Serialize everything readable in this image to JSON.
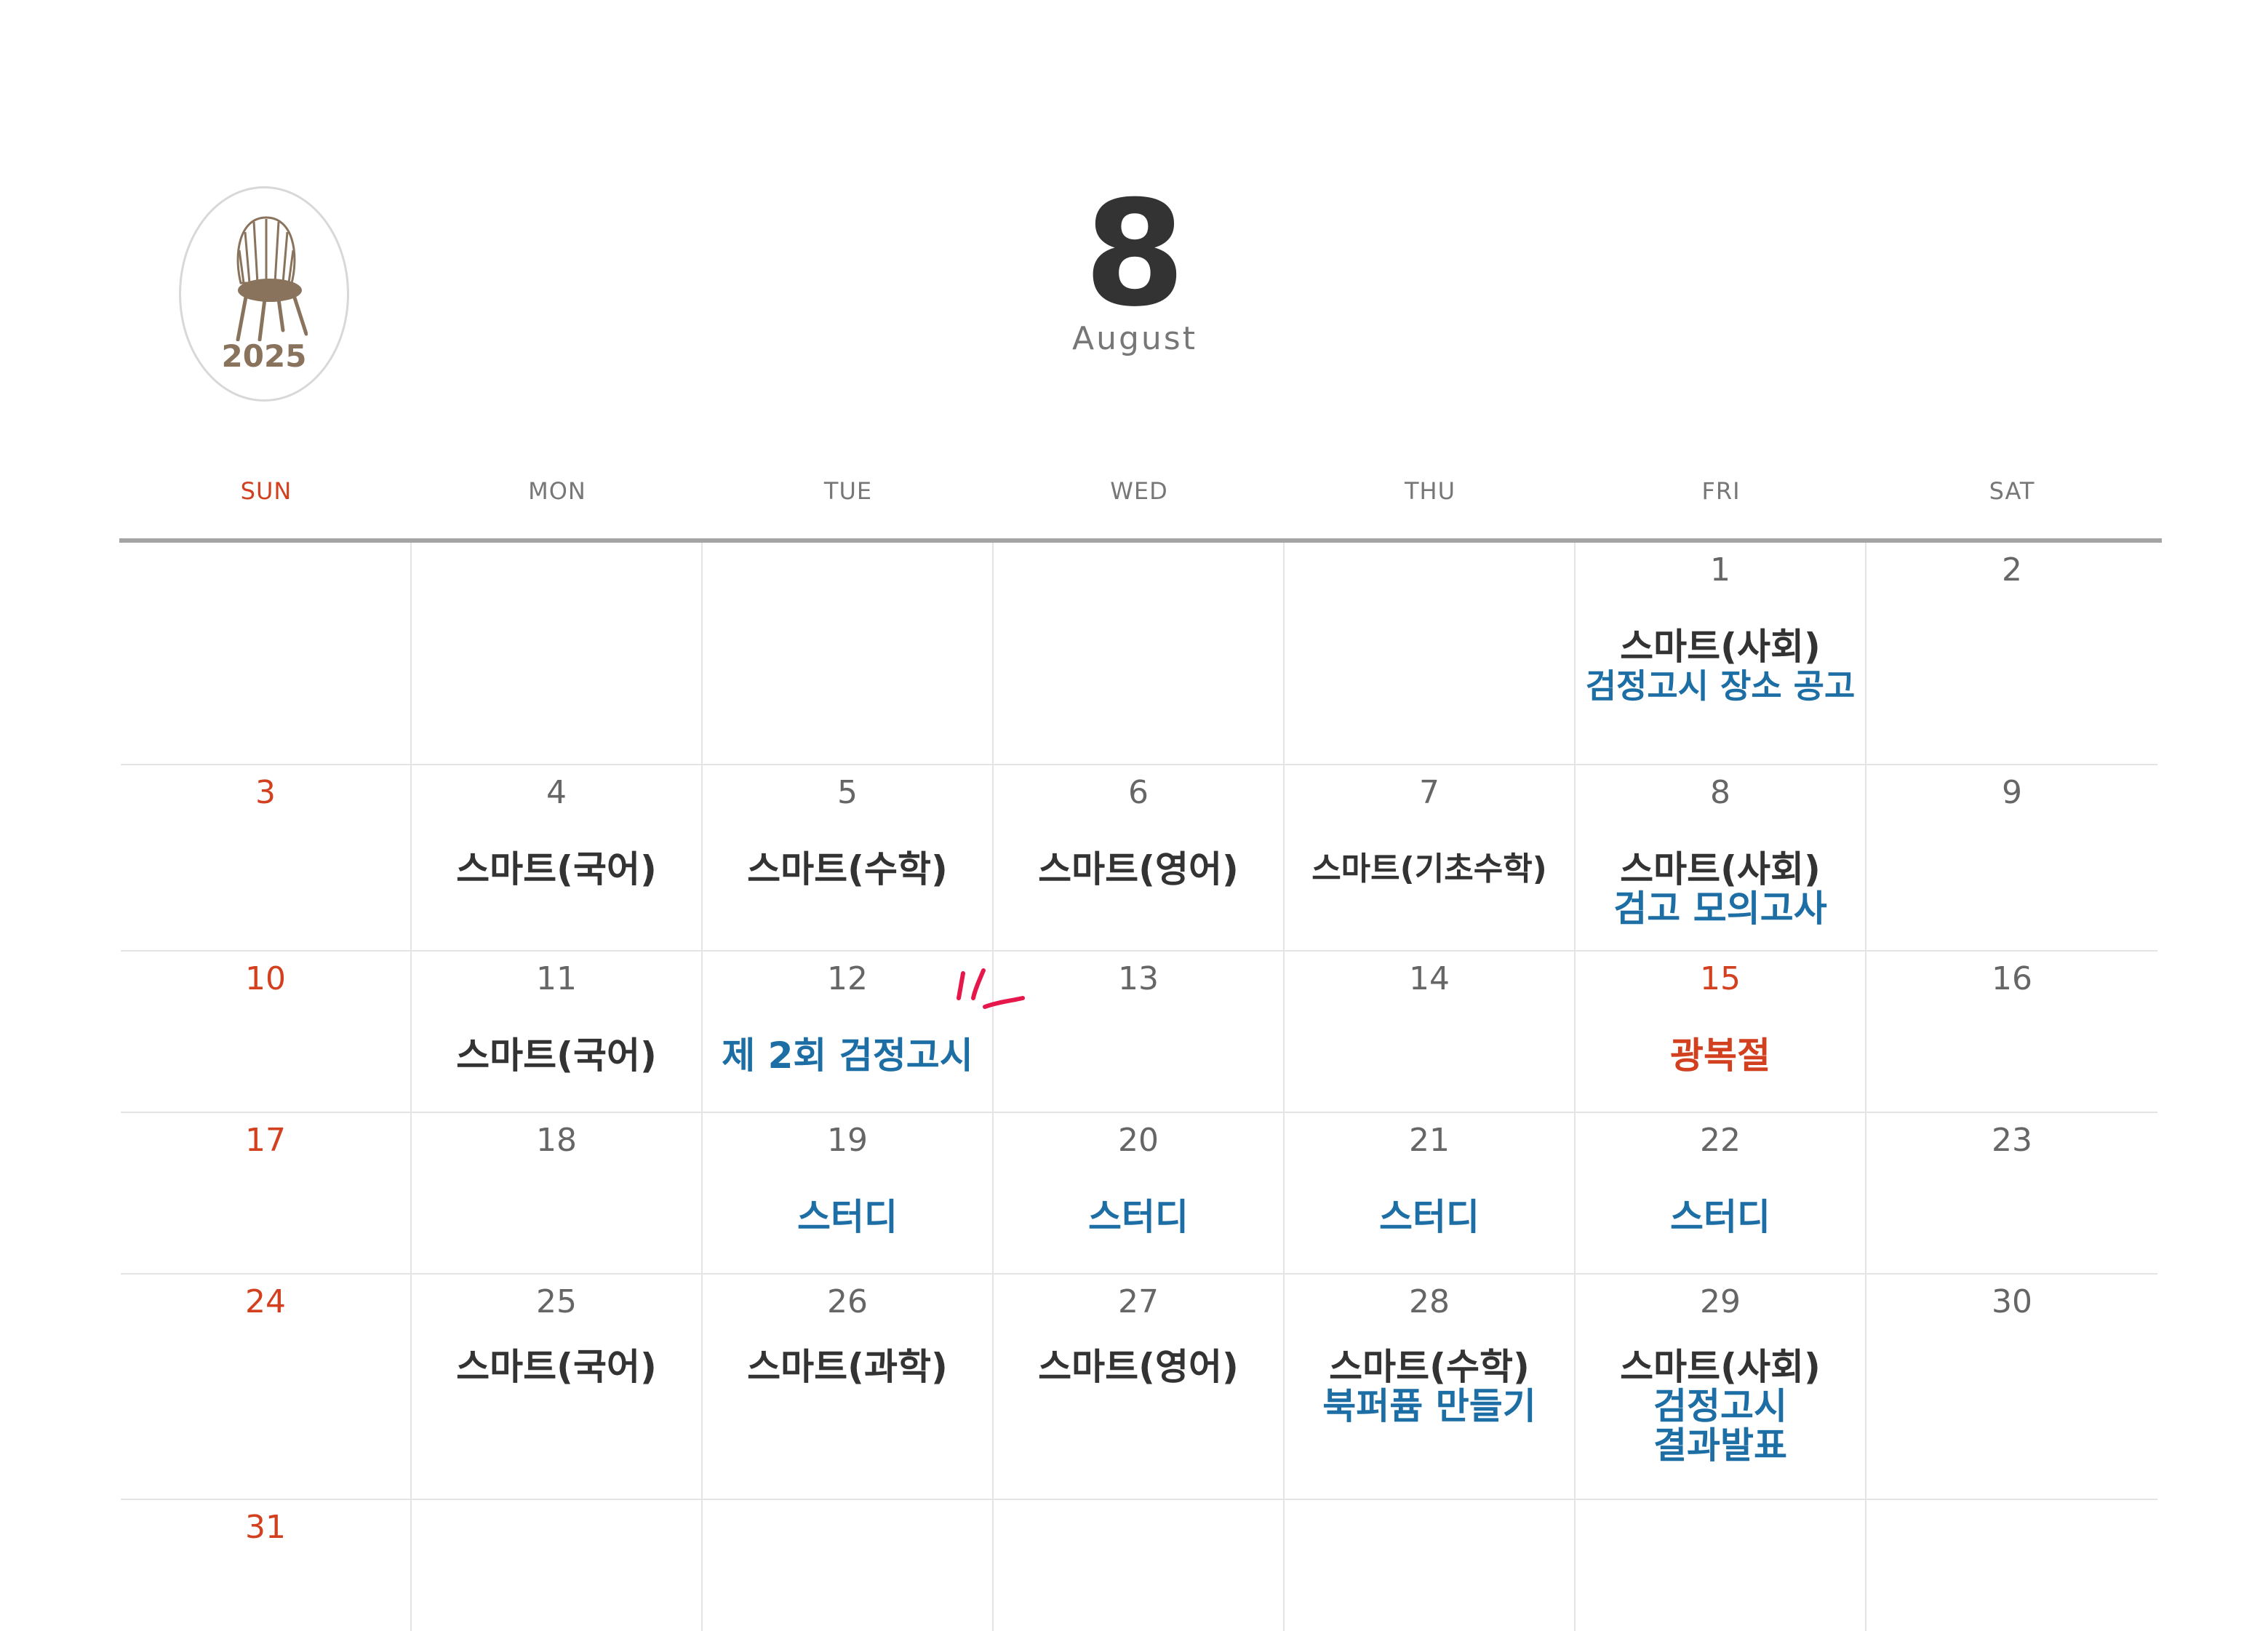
{
  "logo": {
    "year": "2025",
    "icon": "chair-icon",
    "color": "#8a735c"
  },
  "month": {
    "number": "8",
    "name": "August"
  },
  "weekdays": [
    "SUN",
    "MON",
    "TUE",
    "WED",
    "THU",
    "FRI",
    "SAT"
  ],
  "colors": {
    "sunday": "#d2401f",
    "event_dark": "#333333",
    "event_blue": "#1c6ea4",
    "grid": "#e4e4e4",
    "header_rule": "#a4a4a4"
  },
  "annotation": {
    "icon": "red-marker-strokes-icon"
  },
  "weeks": [
    {
      "days": [
        {
          "n": "",
          "events": []
        },
        {
          "n": "",
          "events": []
        },
        {
          "n": "",
          "events": []
        },
        {
          "n": "",
          "events": []
        },
        {
          "n": "",
          "events": []
        },
        {
          "n": "1",
          "events": [
            {
              "t": "스마트(사회)",
              "s": "big"
            },
            {
              "t": "검정고시 장소 공고",
              "s": "blue"
            }
          ]
        },
        {
          "n": "2",
          "events": []
        }
      ]
    },
    {
      "days": [
        {
          "n": "3",
          "red": true,
          "events": []
        },
        {
          "n": "4",
          "events": [
            {
              "t": "스마트(국어)",
              "s": "big"
            }
          ]
        },
        {
          "n": "5",
          "events": [
            {
              "t": "스마트(수학)",
              "s": "big"
            }
          ]
        },
        {
          "n": "6",
          "events": [
            {
              "t": "스마트(영어)",
              "s": "big"
            }
          ]
        },
        {
          "n": "7",
          "events": [
            {
              "t": "스마트(기초수학)",
              "s": "big tight"
            }
          ]
        },
        {
          "n": "8",
          "events": [
            {
              "t": "스마트(사회)",
              "s": "big"
            },
            {
              "t": "검고 모의고사",
              "s": "blue-big"
            }
          ]
        },
        {
          "n": "9",
          "events": []
        }
      ]
    },
    {
      "days": [
        {
          "n": "10",
          "red": true,
          "events": []
        },
        {
          "n": "11",
          "events": [
            {
              "t": "스마트(국어)",
              "s": "big"
            }
          ]
        },
        {
          "n": "12",
          "events": [
            {
              "t": "제 2회 검정고시",
              "s": "blue-big"
            }
          ]
        },
        {
          "n": "13",
          "events": []
        },
        {
          "n": "14",
          "events": []
        },
        {
          "n": "15",
          "red": true,
          "events": [
            {
              "t": "광복절",
              "s": "holiday"
            }
          ]
        },
        {
          "n": "16",
          "events": []
        }
      ]
    },
    {
      "days": [
        {
          "n": "17",
          "red": true,
          "events": []
        },
        {
          "n": "18",
          "events": []
        },
        {
          "n": "19",
          "events": [
            {
              "t": "스터디",
              "s": "blue-big"
            }
          ]
        },
        {
          "n": "20",
          "events": [
            {
              "t": "스터디",
              "s": "blue-big"
            }
          ]
        },
        {
          "n": "21",
          "events": [
            {
              "t": "스터디",
              "s": "blue-big"
            }
          ]
        },
        {
          "n": "22",
          "events": [
            {
              "t": "스터디",
              "s": "blue-big"
            }
          ]
        },
        {
          "n": "23",
          "events": []
        }
      ]
    },
    {
      "days": [
        {
          "n": "24",
          "red": true,
          "events": []
        },
        {
          "n": "25",
          "events": [
            {
              "t": "스마트(국어)",
              "s": "big"
            }
          ]
        },
        {
          "n": "26",
          "events": [
            {
              "t": "스마트(과학)",
              "s": "big"
            }
          ]
        },
        {
          "n": "27",
          "events": [
            {
              "t": "스마트(영어)",
              "s": "big"
            }
          ]
        },
        {
          "n": "28",
          "events": [
            {
              "t": "스마트(수학)",
              "s": "big"
            },
            {
              "t": "북퍼퓸 만들기",
              "s": "blue-big"
            }
          ]
        },
        {
          "n": "29",
          "events": [
            {
              "t": "스마트(사회)",
              "s": "big"
            },
            {
              "t": "검정고시",
              "s": "blue-big"
            },
            {
              "t": "결과발표",
              "s": "blue-big"
            }
          ]
        },
        {
          "n": "30",
          "events": []
        }
      ]
    },
    {
      "days": [
        {
          "n": "31",
          "red": true,
          "events": []
        },
        {
          "n": "",
          "events": []
        },
        {
          "n": "",
          "events": []
        },
        {
          "n": "",
          "events": []
        },
        {
          "n": "",
          "events": []
        },
        {
          "n": "",
          "events": []
        },
        {
          "n": "",
          "events": []
        }
      ]
    }
  ]
}
